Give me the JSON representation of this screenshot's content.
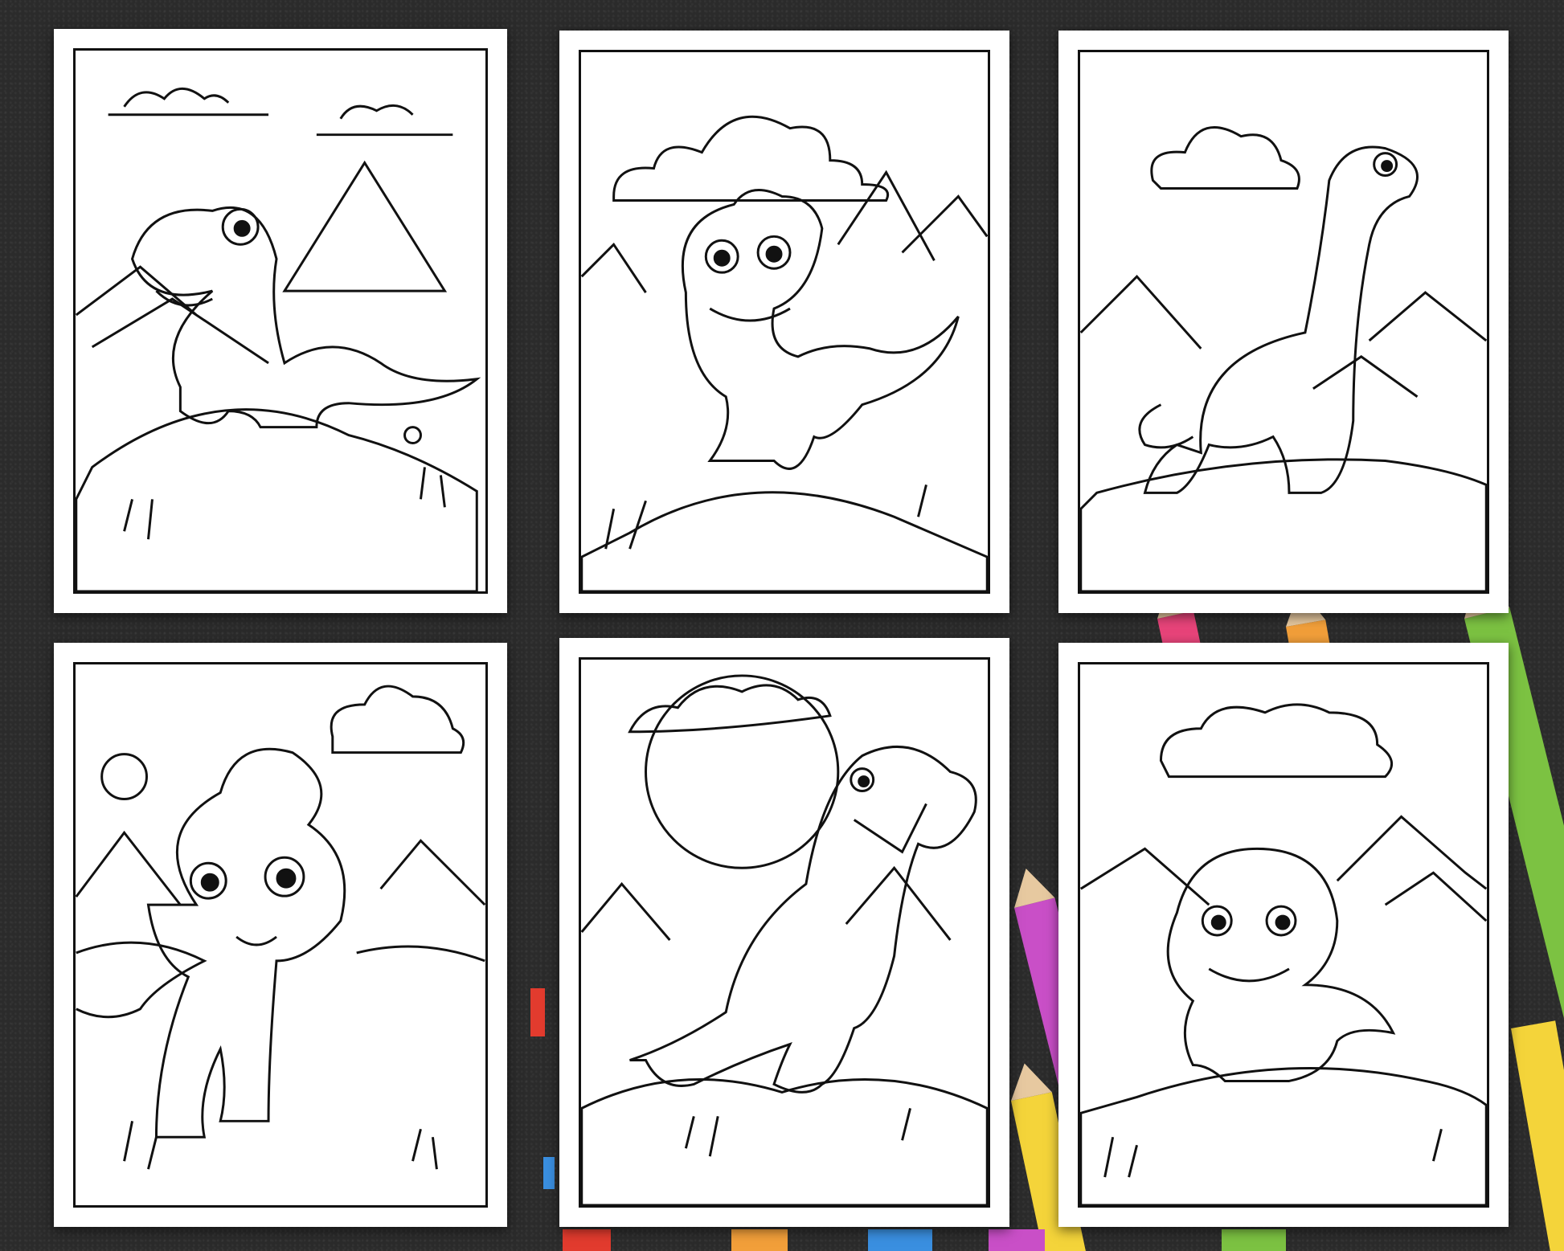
{
  "scene": {
    "background_color": "#2b2b2b",
    "page_count": 6,
    "pages": [
      {
        "name": "coloring-page-1",
        "subject": "dinosaur-on-rock",
        "icon": "dinosaur-icon"
      },
      {
        "name": "coloring-page-2",
        "subject": "spiked-dinosaur",
        "icon": "dinosaur-icon"
      },
      {
        "name": "coloring-page-3",
        "subject": "long-neck-dinosaur",
        "icon": "dinosaur-icon"
      },
      {
        "name": "coloring-page-4",
        "subject": "baby-dinosaur-with-hair",
        "icon": "dinosaur-icon"
      },
      {
        "name": "coloring-page-5",
        "subject": "roaring-dinosaur",
        "icon": "dinosaur-icon"
      },
      {
        "name": "coloring-page-6",
        "subject": "round-head-dinosaur",
        "icon": "dinosaur-icon"
      }
    ],
    "pencil_colors": [
      "#e8447a",
      "#f29f3a",
      "#7cc242",
      "#c94fc7",
      "#f4d43a",
      "#3a8fe0",
      "#e23b2e"
    ]
  }
}
